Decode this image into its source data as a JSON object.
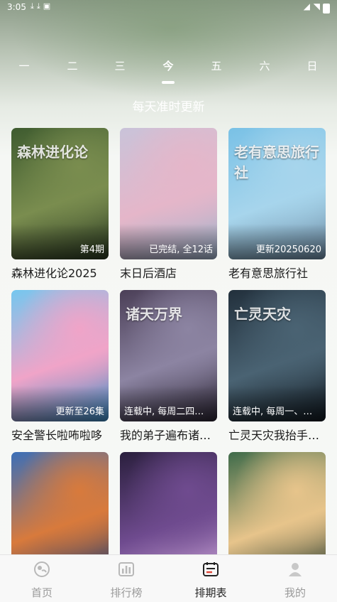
{
  "status_bar": {
    "time": "3:05",
    "icons": [
      "download-icon",
      "download-icon",
      "app-icon"
    ],
    "right_icons": [
      "signal-icon",
      "wifi-icon",
      "battery-icon"
    ]
  },
  "week_tabs": [
    {
      "label": "一",
      "active": false
    },
    {
      "label": "二",
      "active": false
    },
    {
      "label": "三",
      "active": false
    },
    {
      "label": "今",
      "active": true
    },
    {
      "label": "五",
      "active": false
    },
    {
      "label": "六",
      "active": false
    },
    {
      "label": "日",
      "active": false
    }
  ],
  "subtitle": "每天准时更新",
  "cards": [
    {
      "title": "森林进化论2025",
      "badge": "第4期",
      "poster_text": "森林进化论",
      "colors": [
        "#3e5b2f",
        "#7a8d4f",
        "#2b3a22"
      ]
    },
    {
      "title": "末日后酒店",
      "badge": "已完结, 全12话",
      "poster_text": "",
      "colors": [
        "#c9c3d9",
        "#e5b6c9",
        "#9fb3cc"
      ]
    },
    {
      "title": "老有意思旅行社",
      "badge": "更新20250620",
      "poster_text": "老有意思旅行社",
      "colors": [
        "#79c1e6",
        "#a7d5ec",
        "#6f8da5"
      ]
    },
    {
      "title": "安全警长啦咘啦哆",
      "badge": "更新至26集",
      "poster_text": "",
      "colors": [
        "#74c7ef",
        "#f0a4c8",
        "#3b8cc4"
      ]
    },
    {
      "title": "我的弟子遍布诸天万界",
      "badge": "连载中, 每周二四六更新",
      "poster_text": "诸天万界",
      "colors": [
        "#4b3f57",
        "#8c84a2",
        "#2b2533"
      ]
    },
    {
      "title": "亡灵天灾我抬手百万骷髅",
      "badge": "连载中, 每周一、三更新",
      "poster_text": "亡灵天灾",
      "colors": [
        "#22303c",
        "#4a6373",
        "#10181f"
      ]
    },
    {
      "title": "",
      "badge": "",
      "poster_text": "",
      "colors": [
        "#3b6fb8",
        "#d87a3c",
        "#1f3a6e"
      ]
    },
    {
      "title": "",
      "badge": "",
      "poster_text": "",
      "colors": [
        "#2a1f3d",
        "#6f4b8f",
        "#c8a2d4"
      ]
    },
    {
      "title": "",
      "badge": "",
      "poster_text": "",
      "colors": [
        "#3e6b4a",
        "#e7c48b",
        "#2a3d30"
      ]
    }
  ],
  "bottom_nav": [
    {
      "label": "首页",
      "icon": "home-icon",
      "active": false
    },
    {
      "label": "排行榜",
      "icon": "ranking-icon",
      "active": false
    },
    {
      "label": "排期表",
      "icon": "schedule-icon",
      "active": true
    },
    {
      "label": "我的",
      "icon": "profile-icon",
      "active": false
    }
  ],
  "colors": {
    "active_text": "#222222",
    "inactive_text": "#9a9a9a"
  }
}
